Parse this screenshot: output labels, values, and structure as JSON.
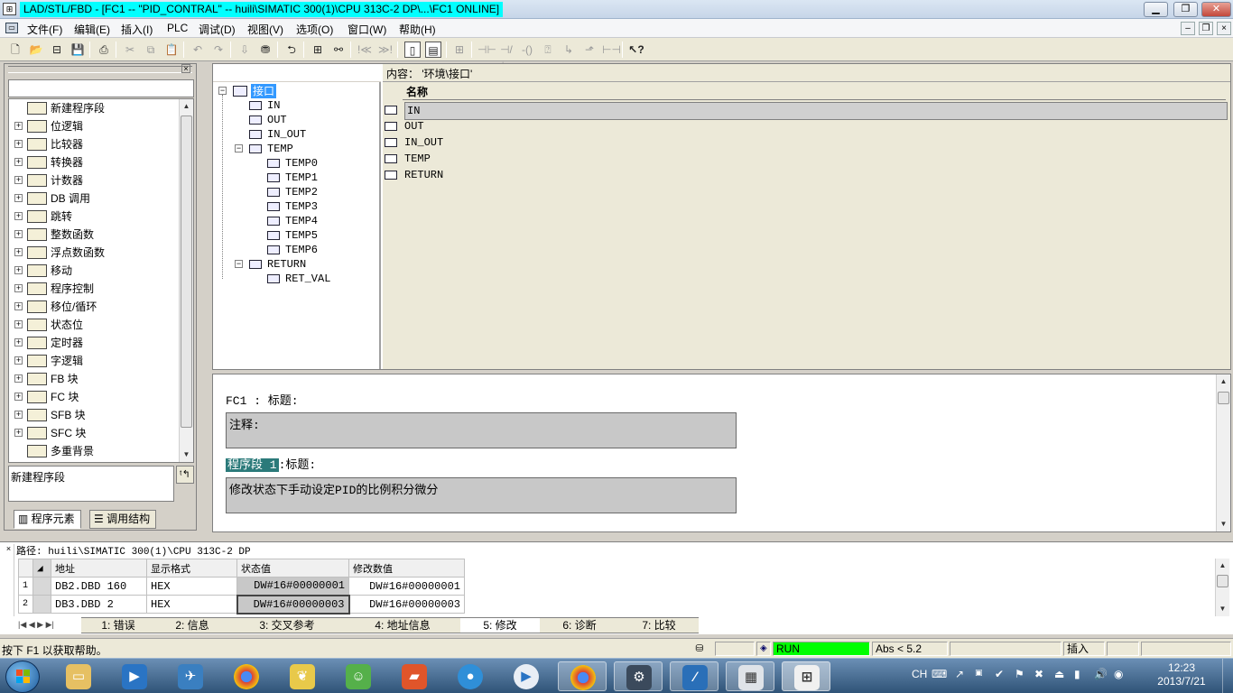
{
  "window": {
    "title": "LAD/STL/FBD  - [FC1 -- \"PID_CONTRAL\" -- huili\\SIMATIC 300(1)\\CPU 313C-2 DP\\...\\FC1  ONLINE]",
    "app_icon": "simatic-editor-icon"
  },
  "menu": {
    "items": [
      "文件(F)",
      "编辑(E)",
      "插入(I)",
      "PLC",
      "调试(D)",
      "视图(V)",
      "选项(O)",
      "窗口(W)",
      "帮助(H)"
    ]
  },
  "left_panel": {
    "tree": [
      {
        "label": "新建程序段",
        "icon": "new-network-icon",
        "expandable": false
      },
      {
        "label": "位逻辑",
        "icon": "bit-logic-icon",
        "expandable": true
      },
      {
        "label": "比较器",
        "icon": "comparator-icon",
        "expandable": true
      },
      {
        "label": "转换器",
        "icon": "converter-icon",
        "expandable": true
      },
      {
        "label": "计数器",
        "icon": "counter-icon",
        "expandable": true
      },
      {
        "label": "DB 调用",
        "icon": "db-call-icon",
        "expandable": true
      },
      {
        "label": "跳转",
        "icon": "jump-icon",
        "expandable": true
      },
      {
        "label": "整数函数",
        "icon": "integer-function-icon",
        "expandable": true
      },
      {
        "label": "浮点数函数",
        "icon": "float-function-icon",
        "expandable": true
      },
      {
        "label": "移动",
        "icon": "move-icon",
        "expandable": true
      },
      {
        "label": "程序控制",
        "icon": "program-control-icon",
        "expandable": true
      },
      {
        "label": "移位/循环",
        "icon": "shift-rotate-icon",
        "expandable": true
      },
      {
        "label": "状态位",
        "icon": "status-bit-icon",
        "expandable": true
      },
      {
        "label": "定时器",
        "icon": "timer-icon",
        "expandable": true
      },
      {
        "label": "字逻辑",
        "icon": "word-logic-icon",
        "expandable": true
      },
      {
        "label": "FB 块",
        "icon": "fb-block-icon",
        "expandable": true
      },
      {
        "label": "FC 块",
        "icon": "fc-block-icon",
        "expandable": true
      },
      {
        "label": "SFB 块",
        "icon": "sfb-block-icon",
        "expandable": true
      },
      {
        "label": "SFC 块",
        "icon": "sfc-block-icon",
        "expandable": true
      },
      {
        "label": "多重背景",
        "icon": "multi-instance-icon",
        "expandable": false
      }
    ],
    "description": "新建程序段",
    "tabs": [
      "程序元素",
      "调用结构"
    ]
  },
  "interface": {
    "root": "接口",
    "nodes": [
      "IN",
      "OUT",
      "IN_OUT",
      "TEMP"
    ],
    "temp_children": [
      "TEMP0",
      "TEMP1",
      "TEMP2",
      "TEMP3",
      "TEMP4",
      "TEMP5",
      "TEMP6"
    ],
    "return_node": "RETURN",
    "return_children": [
      "RET_VAL"
    ],
    "content_header": "内容：  '环境\\接口'",
    "column_header": "名称",
    "rows": [
      "IN",
      "OUT",
      "IN_OUT",
      "TEMP",
      "RETURN"
    ]
  },
  "code": {
    "block_title": "FC1 : 标题:",
    "comment_label": "注释:",
    "network_label": "程序段 1",
    "network_title": ":标题:",
    "network_comment": "修改状态下手动设定PID的比例积分微分"
  },
  "details": {
    "path": "路径:  huili\\SIMATIC 300(1)\\CPU 313C-2 DP",
    "columns": [
      "地址",
      "显示格式",
      "状态值",
      "修改数值"
    ],
    "rows": [
      {
        "no": "1",
        "address": "DB2.DBD   160",
        "format": "HEX",
        "state": "DW#16#00000001",
        "modify": "DW#16#00000001"
      },
      {
        "no": "2",
        "address": "DB3.DBD     2",
        "format": "HEX",
        "state": "DW#16#00000003",
        "modify": "DW#16#00000003"
      }
    ],
    "tabs": [
      "1: 错误",
      "2: 信息",
      "3: 交叉参考",
      "4: 地址信息",
      "5: 修改",
      "6: 诊断",
      "7: 比较"
    ],
    "active_tab": "5: 修改"
  },
  "status": {
    "help": "按下 F1 以获取帮助。",
    "run": "RUN",
    "abs": "Abs < 5.2",
    "mode": "插入",
    "run_color": "#00ff00"
  },
  "taskbar": {
    "time": "12:23",
    "date": "2013/7/21",
    "lang": "CH"
  }
}
